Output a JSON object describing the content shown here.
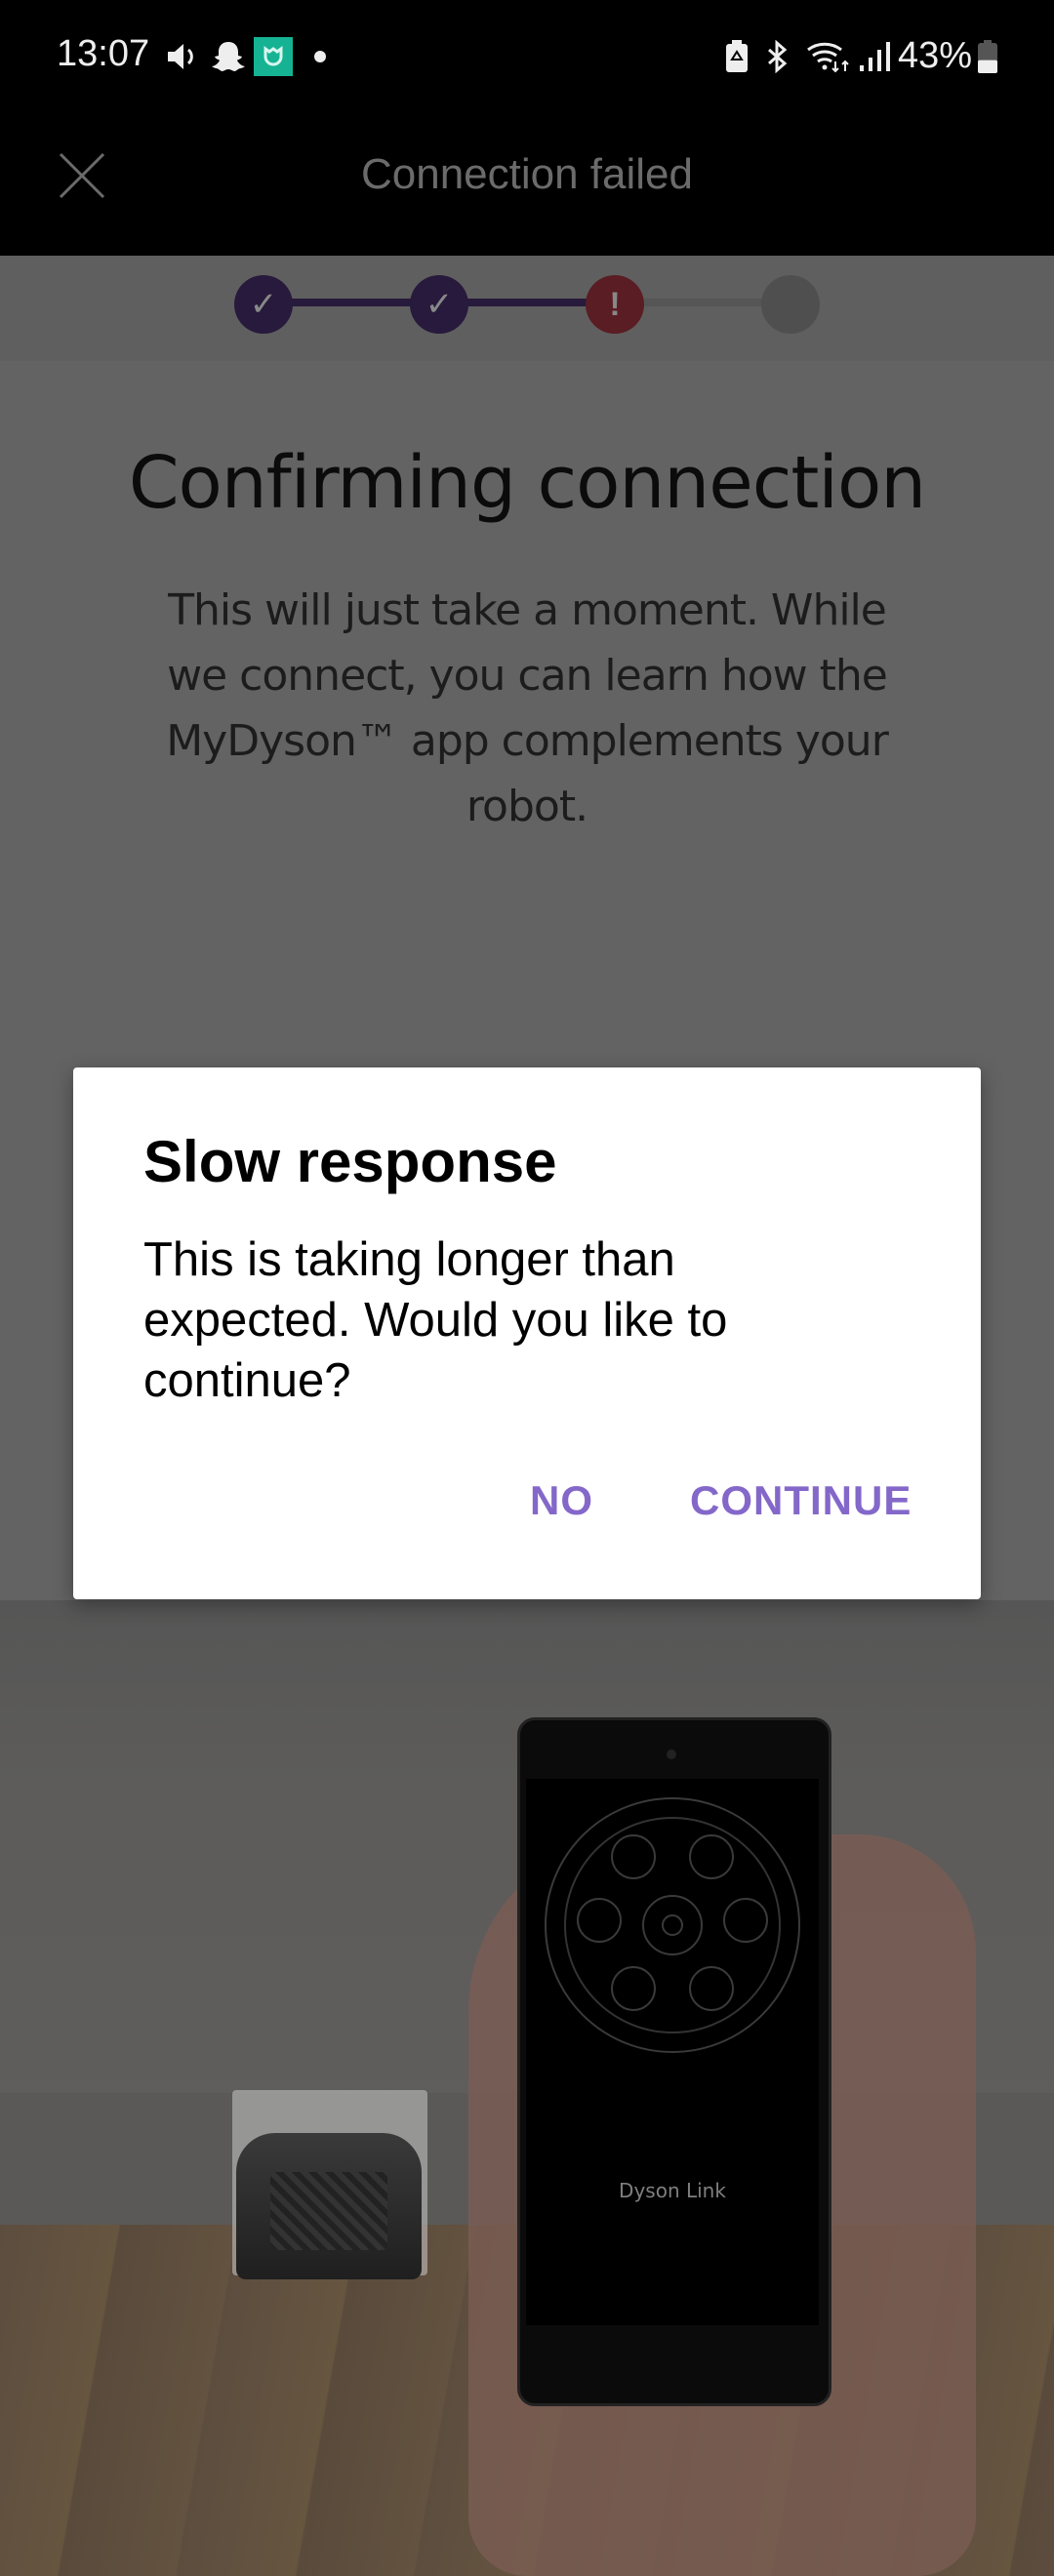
{
  "status_bar": {
    "time": "13:07",
    "left_icons": [
      "volume-icon",
      "snapchat-icon",
      "mi-home-icon",
      "notification-dot-icon"
    ],
    "right_icons": [
      "battery-saver-icon",
      "bluetooth-icon",
      "wifi-icon",
      "signal-icon"
    ],
    "battery_percent": "43%",
    "battery_level": 0.43
  },
  "app_bar": {
    "close_icon": "close-icon",
    "title": "Connection failed"
  },
  "stepper": {
    "steps": [
      {
        "state": "complete",
        "icon": "check-icon",
        "glyph": "✓"
      },
      {
        "state": "complete",
        "icon": "check-icon",
        "glyph": "✓"
      },
      {
        "state": "error",
        "icon": "exclamation-icon",
        "glyph": "!"
      },
      {
        "state": "pending",
        "icon": "",
        "glyph": ""
      }
    ],
    "colors": {
      "complete": "#271a3c",
      "error": "#5a1d23",
      "pending": "#4f4f4f",
      "line_complete": "#271a3c",
      "line_pending": "#565656"
    }
  },
  "main": {
    "heading": "Confirming connection",
    "body": "This will just take a moment. While we connect, you can learn how the MyDyson™ app complements your robot."
  },
  "illustration": {
    "phone_screen_label": "Dyson Link",
    "description": "Hand holding phone next to robot vacuum on dock"
  },
  "carousel": {
    "page_count": 4,
    "active_index": 0
  },
  "dialog": {
    "title": "Slow response",
    "message": "This is taking longer than expected. Would you like to continue?",
    "buttons": {
      "no": "NO",
      "continue": "CONTINUE"
    },
    "accent_color": "#8468c9"
  }
}
